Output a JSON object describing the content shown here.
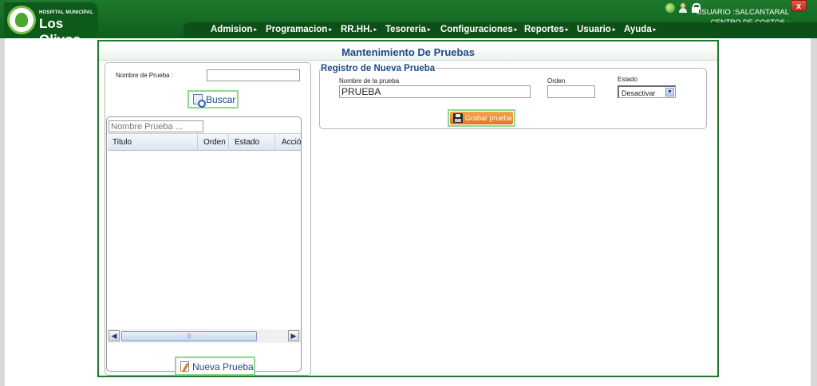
{
  "header": {
    "logo_small": "HOSPITAL MUNICIPAL",
    "logo_big": "Los Olivos",
    "user": "USUARIO :SALCANTARAL",
    "cost_center": "CENTRO DE COSTOS :",
    "close_label": "x",
    "menu": [
      {
        "label": "Admision"
      },
      {
        "label": "Programacion"
      },
      {
        "label": "RR.HH."
      },
      {
        "label": "Tesoreria"
      },
      {
        "label": "Configuraciones"
      },
      {
        "label": "Reportes"
      },
      {
        "label": "Usuario"
      },
      {
        "label": "Ayuda"
      }
    ],
    "menu_arrow": "▸"
  },
  "panel": {
    "title": "Mantenimiento De Pruebas"
  },
  "search": {
    "name_label": "Nombre de Prueba :",
    "name_value": "",
    "buscar_label": "Buscar",
    "filter_placeholder": "Nombre Prueba ...",
    "columns": [
      "Titulo",
      "Orden",
      "Estado",
      "Acción"
    ],
    "scroll_left": "◀",
    "scroll_right": "▶",
    "scroll_grip": "|||",
    "nueva_label": "Nueva Prueba"
  },
  "registro": {
    "title": "Registro de Nueva Prueba",
    "name_label": "Nombre de la prueba",
    "name_value": "PRUEBA",
    "orden_label": "Orden",
    "orden_value": "",
    "estado_label": "Estado",
    "estado_value": "Desactivar",
    "estado_arrow": "▼",
    "grabar_label": "Grabar prueba"
  },
  "colors": {
    "header_green": "#1d7a2c",
    "panel_border": "#1e7a2a",
    "title_blue": "#1a4a8a",
    "button_highlight": "#8fd98f",
    "save_orange": "#e07818"
  },
  "icons": [
    "globe-icon",
    "user-icon",
    "lock-icon",
    "close-icon",
    "search-icon",
    "edit-icon",
    "floppy-disk-icon",
    "chevron-down-icon"
  ]
}
